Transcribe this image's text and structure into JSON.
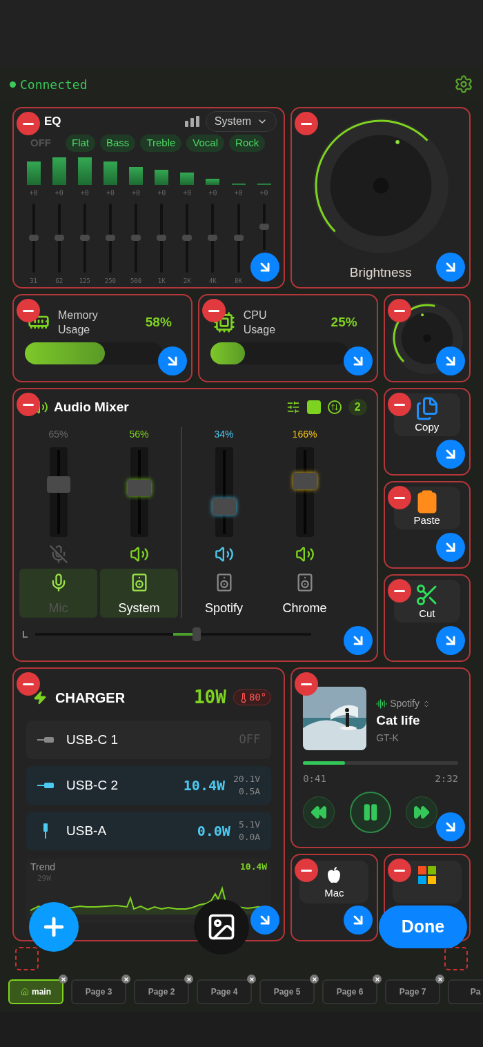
{
  "status": {
    "text": "Connected",
    "connected": true
  },
  "eq": {
    "title": "EQ",
    "device": "System",
    "power": "OFF",
    "presets": [
      "Flat",
      "Bass",
      "Treble",
      "Vocal",
      "Rock"
    ],
    "bands": [
      {
        "gain": "+0",
        "freq": "31",
        "level": 0.5
      },
      {
        "gain": "+0",
        "freq": "62",
        "level": 0.5
      },
      {
        "gain": "+0",
        "freq": "125",
        "level": 0.5
      },
      {
        "gain": "+0",
        "freq": "250",
        "level": 0.5
      },
      {
        "gain": "+0",
        "freq": "500",
        "level": 0.5
      },
      {
        "gain": "+0",
        "freq": "1K",
        "level": 0.5
      },
      {
        "gain": "+0",
        "freq": "2K",
        "level": 0.5
      },
      {
        "gain": "+0",
        "freq": "4K",
        "level": 0.5
      },
      {
        "gain": "+0",
        "freq": "8K",
        "level": 0.5
      },
      {
        "gain": "+0",
        "level": 0.5
      }
    ]
  },
  "brightness": {
    "label": "Brightness"
  },
  "memory": {
    "label": "Memory Usage",
    "value": "58%",
    "level": 0.58
  },
  "cpu": {
    "label": "CPU Usage",
    "value": "25%",
    "level": 0.25
  },
  "mixer": {
    "title": "Audio Mixer",
    "count": "2",
    "balance": {
      "label": "L",
      "level": 0.6
    },
    "channels": [
      {
        "name": "Mic",
        "kind": "mic",
        "percent": "65%",
        "color": "#6b6b6b",
        "level": 0.6,
        "muted": true,
        "selected": true
      },
      {
        "name": "System",
        "kind": "system",
        "percent": "56%",
        "color": "#7ed321",
        "level": 0.55,
        "muted": false,
        "selected": true
      },
      {
        "name": "Spotify",
        "kind": "app",
        "percent": "34%",
        "color": "#4cc9f0",
        "level": 0.3,
        "muted": false,
        "selected": false
      },
      {
        "name": "Chrome",
        "kind": "app",
        "percent": "166%",
        "color": "#f5c518",
        "level": 0.65,
        "muted": false,
        "selected": false
      }
    ]
  },
  "shortcuts": [
    {
      "kind": "copy",
      "label": "Copy"
    },
    {
      "kind": "paste",
      "label": "Paste"
    },
    {
      "kind": "cut",
      "label": "Cut"
    }
  ],
  "charger": {
    "title": "CHARGER",
    "power": "10W",
    "temperature": "80°",
    "ports": [
      {
        "kind": "usbc",
        "name": "USB-C 1",
        "active": false,
        "status": "OFF"
      },
      {
        "kind": "usbc",
        "name": "USB-C 2",
        "active": true,
        "power": "10.4W",
        "voltage": "20.1V",
        "current": "0.5A"
      },
      {
        "kind": "usba",
        "name": "USB-A",
        "active": true,
        "power": "0.0W",
        "voltage": "5.1V",
        "current": "0.0A"
      }
    ],
    "trend": {
      "label": "Trend",
      "value": "10.4W",
      "axis": "29W"
    }
  },
  "media": {
    "source": "Spotify",
    "title": "Cat life",
    "artist": "GT-K",
    "elapsed": "0:41",
    "total": "2:32",
    "level": 0.27,
    "playing": true
  },
  "apps": [
    {
      "kind": "mac",
      "label": "Mac"
    },
    {
      "kind": "windows"
    }
  ],
  "done": "Done",
  "tabs": [
    {
      "label": "main",
      "selected": true
    },
    {
      "label": "Page 3",
      "selected": false
    },
    {
      "label": "Page 2",
      "selected": false
    },
    {
      "label": "Page 4",
      "selected": false
    },
    {
      "label": "Page 5",
      "selected": false
    },
    {
      "label": "Page 6",
      "selected": false
    },
    {
      "label": "Page 7",
      "selected": false
    },
    {
      "label": "Pa",
      "selected": false
    }
  ]
}
